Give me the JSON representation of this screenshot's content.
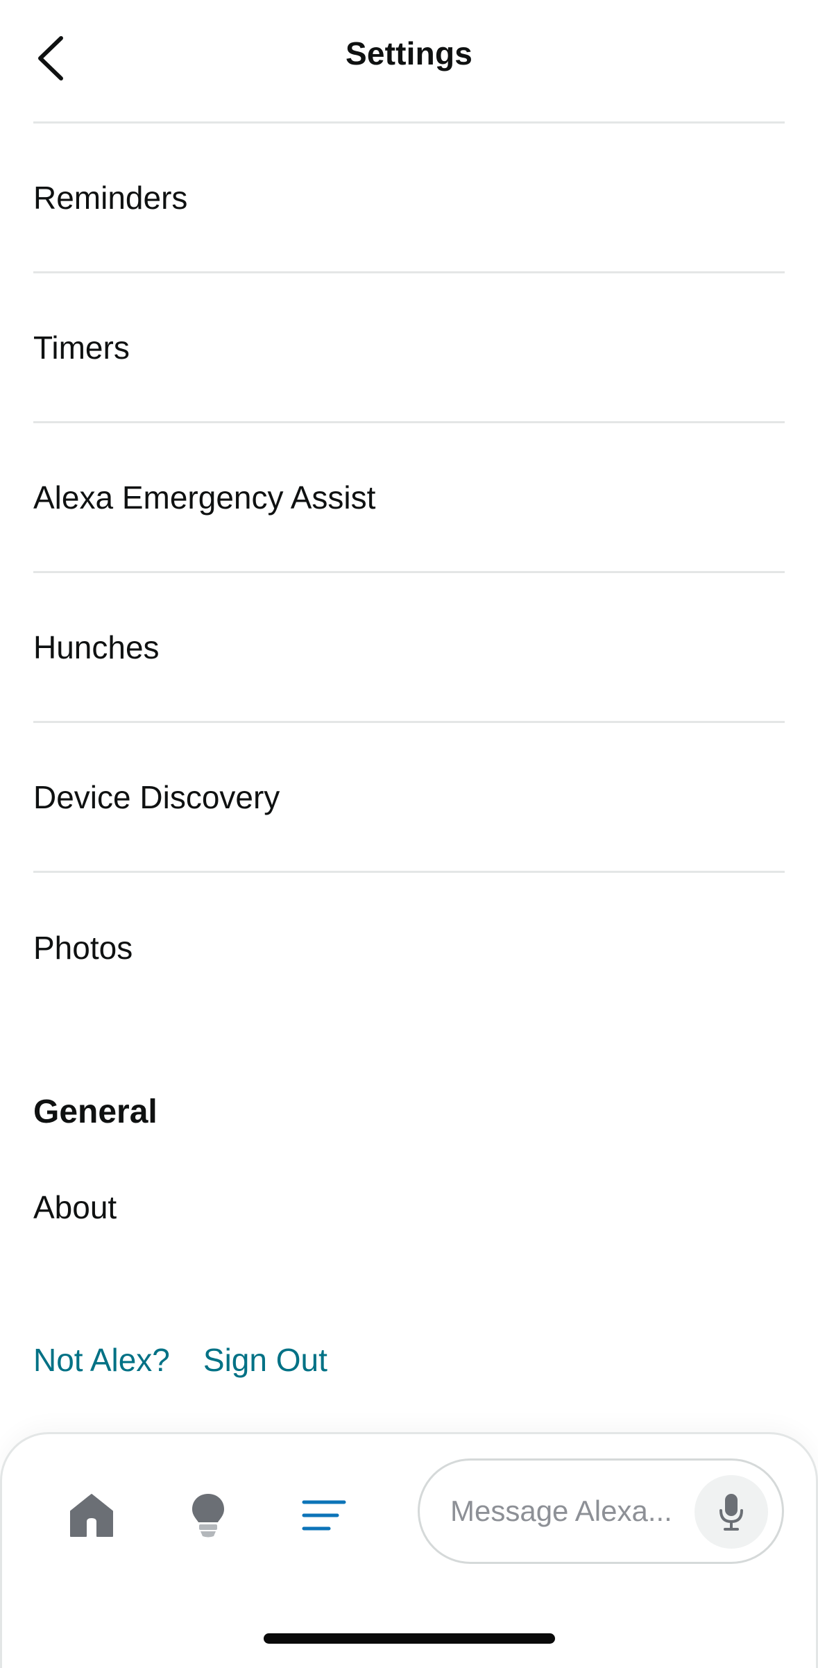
{
  "header": {
    "title": "Settings"
  },
  "settings_list": {
    "items": [
      {
        "label": "Reminders"
      },
      {
        "label": "Timers"
      },
      {
        "label": "Alexa Emergency Assist"
      },
      {
        "label": "Hunches"
      },
      {
        "label": "Device Discovery"
      },
      {
        "label": "Photos"
      }
    ]
  },
  "general_section": {
    "heading": "General",
    "about_label": "About"
  },
  "account": {
    "not_user_label": "Not Alex?",
    "sign_out_label": "Sign Out"
  },
  "bottom_bar": {
    "nav": [
      {
        "icon": "home-icon"
      },
      {
        "icon": "lightbulb-icon"
      },
      {
        "icon": "more-menu-icon",
        "active": true
      }
    ],
    "message_placeholder": "Message Alexa...",
    "mic_icon": "microphone-icon"
  },
  "colors": {
    "link": "#007185",
    "active_nav": "#0c74b8",
    "inactive_nav": "#6b6f75",
    "divider": "#e4e6e6"
  }
}
